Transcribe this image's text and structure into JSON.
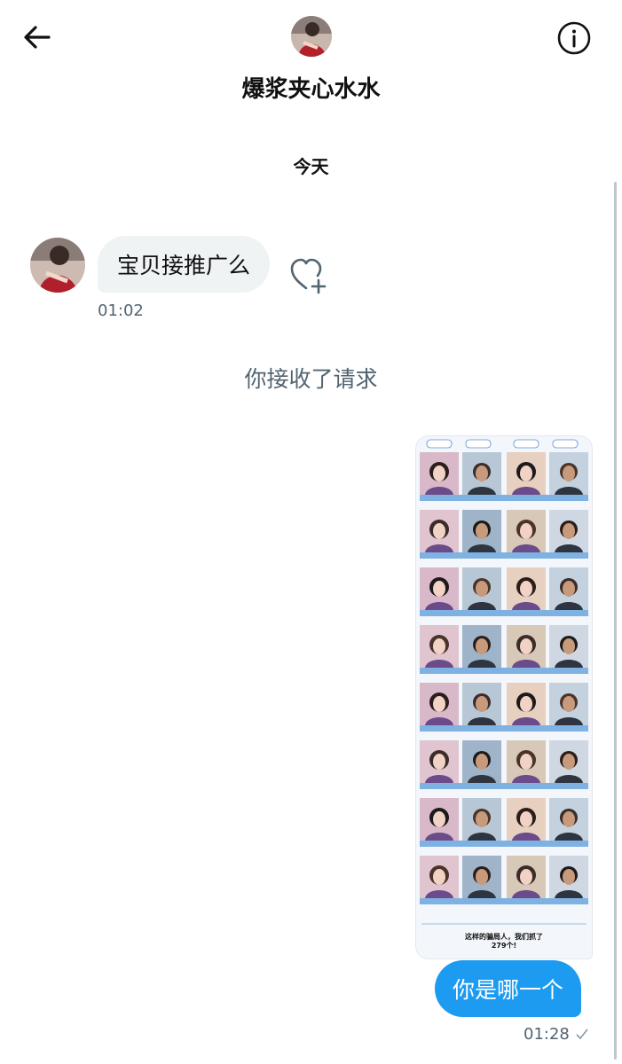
{
  "header": {
    "name": "爆浆夹心水水"
  },
  "conversation": {
    "day_label": "今天",
    "incoming": {
      "text": "宝贝接推广么",
      "time": "01:02"
    },
    "system_text": "你接收了请求",
    "shared_image": {
      "caption_line1": "这样的骗局人，我们抓了",
      "caption_line2": "279个!"
    },
    "outgoing": {
      "text": "你是哪一个",
      "time": "01:28"
    }
  },
  "colors": {
    "accent": "#1d9bf0",
    "bubble_in": "#eff3f4",
    "muted": "#536471"
  }
}
